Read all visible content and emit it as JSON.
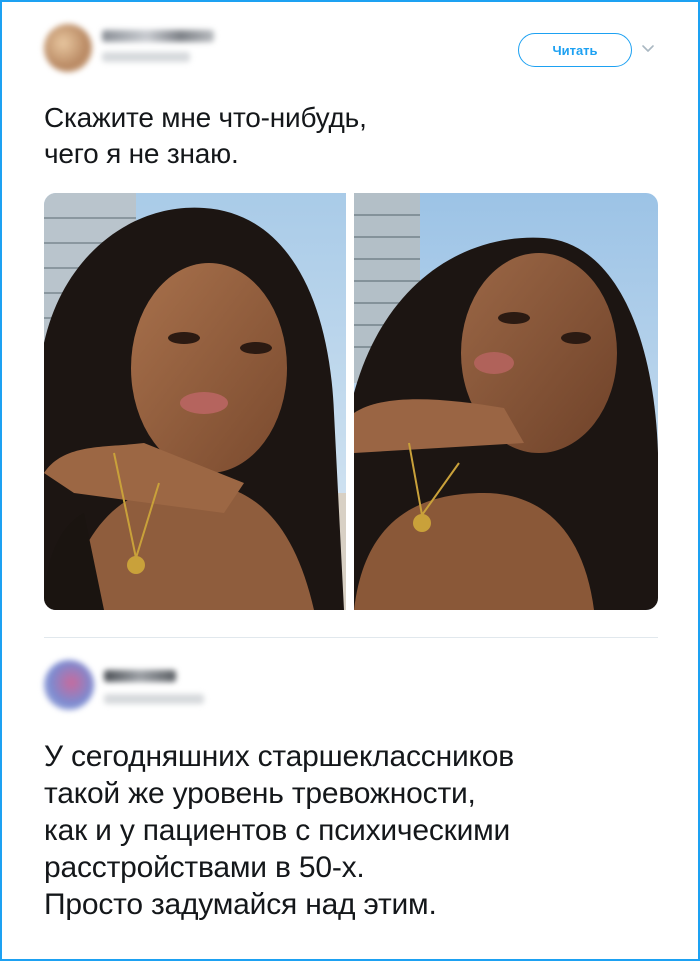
{
  "tweet": {
    "follow_label": "Читать",
    "text": "Скажите мне что-нибудь,\nчего я не знаю."
  },
  "reply": {
    "text": "У сегодняшних старшеклассников\nтакой же уровень тревожности,\nкак и у пациентов с психическими\nрасстройствами в 50-х.\nПросто задумайся над этим."
  },
  "colors": {
    "accent": "#1da1f2",
    "text": "#14171a",
    "divider": "#e1e8ed"
  },
  "icons": {
    "menu": "chevron-down-icon"
  }
}
